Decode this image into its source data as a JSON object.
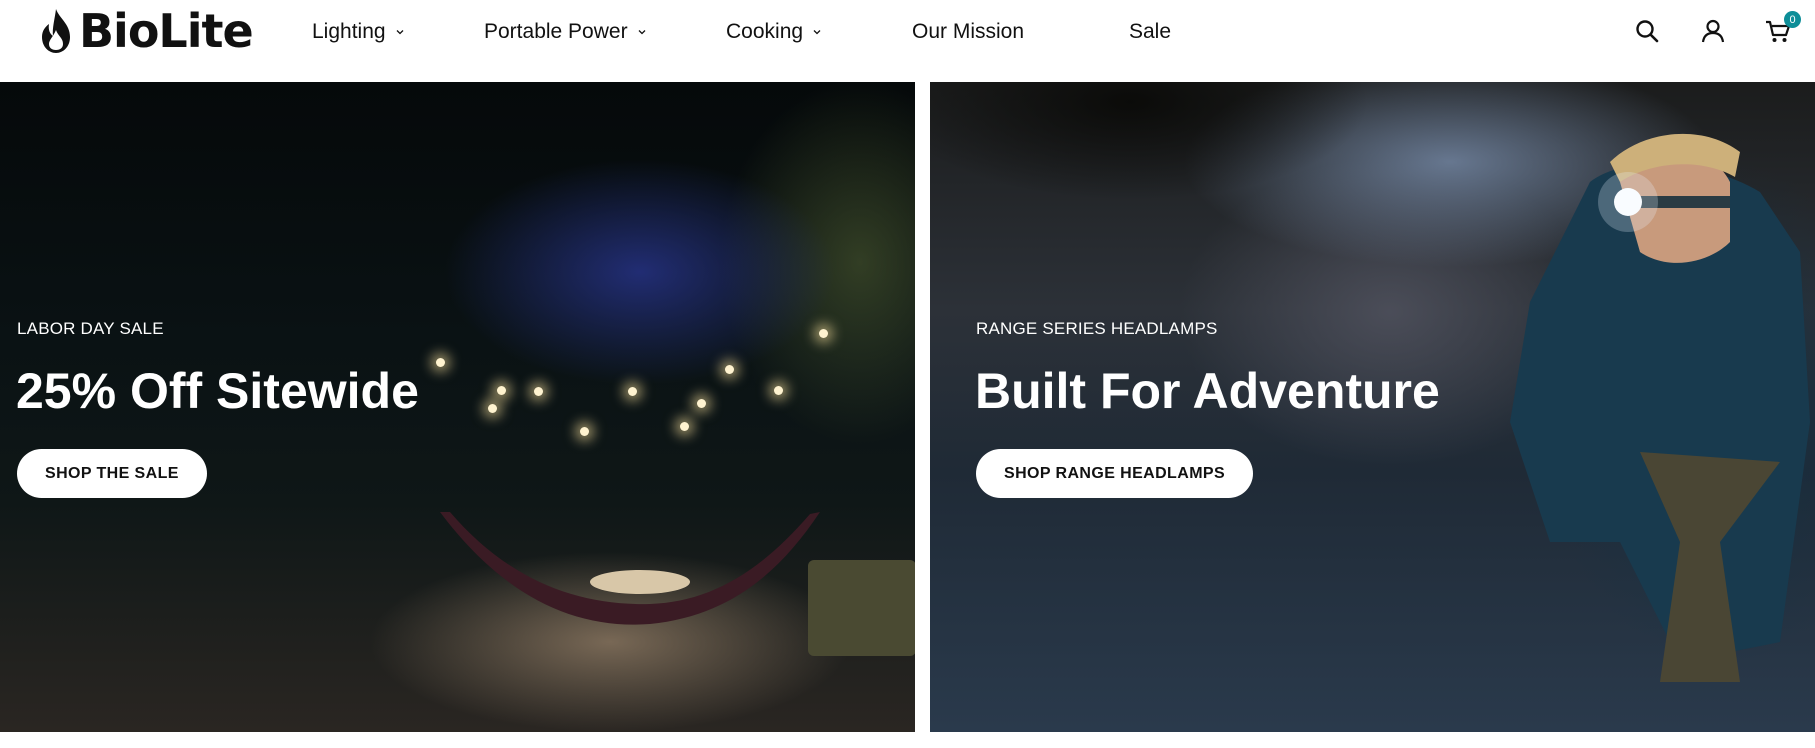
{
  "brand": {
    "name": "BioLite"
  },
  "nav": {
    "items": [
      {
        "label": "Lighting",
        "has_dropdown": true
      },
      {
        "label": "Portable Power",
        "has_dropdown": true
      },
      {
        "label": "Cooking",
        "has_dropdown": true
      },
      {
        "label": "Our Mission",
        "has_dropdown": false
      },
      {
        "label": "Sale",
        "has_dropdown": false
      }
    ]
  },
  "utility": {
    "icons": [
      "search-icon",
      "account-icon",
      "cart-icon"
    ],
    "cart_count": "0",
    "accent_color": "#0d8e98"
  },
  "hero": {
    "left": {
      "eyebrow": "LABOR DAY SALE",
      "headline": "25% Off Sitewide",
      "cta": "SHOP THE SALE"
    },
    "right": {
      "eyebrow": "RANGE SERIES HEADLAMPS",
      "headline": "Built For Adventure",
      "cta": "SHOP RANGE HEADLAMPS"
    }
  }
}
